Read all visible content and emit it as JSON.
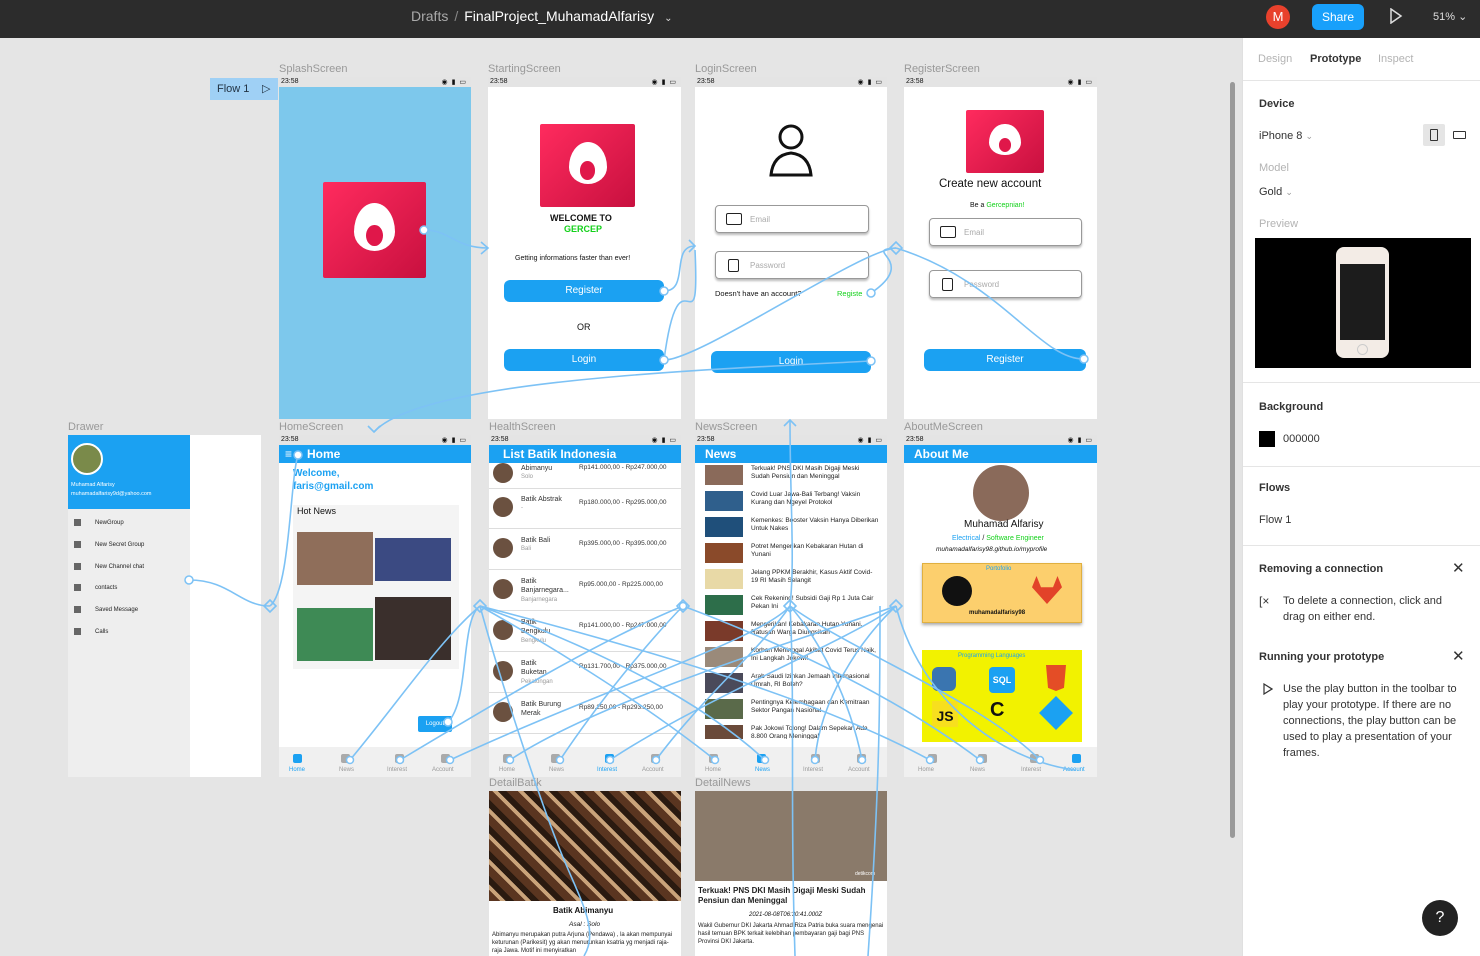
{
  "topbar": {
    "drafts": "Drafts",
    "separator": "/",
    "project": "FinalProject_MuhamadAlfarisy",
    "avatar": "M",
    "share": "Share",
    "zoom": "51%"
  },
  "canvas": {
    "flow_label": "Flow 1",
    "frames": {
      "splash": "SplashScreen",
      "starting": "StartingScreen",
      "login": "LoginScreen",
      "register": "RegisterScreen",
      "drawer": "Drawer",
      "home": "HomeScreen",
      "health": "HealthScreen",
      "news": "NewsScreen",
      "about": "AboutMeScreen",
      "detail_batik": "DetailBatik",
      "detail_news": "DetailNews"
    },
    "statusbar_time": "23:58",
    "starting": {
      "welcome": "WELCOME TO",
      "brand": "GERCEP",
      "tagline": "Getting informations faster than ever!",
      "register": "Register",
      "or": "OR",
      "login": "Login"
    },
    "login": {
      "email": "Email",
      "password": "Password",
      "no_account": "Doesn't have an account?",
      "register_link": "Registe",
      "login": "Login"
    },
    "register": {
      "title": "Create new account",
      "be_a": "Be a",
      "brand": "Gercepnian!",
      "email": "Email",
      "password": "Password",
      "button": "Register"
    },
    "drawer": {
      "name": "Muhamad Alfarisy",
      "email": "muhamadalfarisy9d@yahoo.com",
      "items": [
        "NewGroup",
        "New Secret Group",
        "New Channel chat",
        "contacts",
        "Saved Message",
        "Calls"
      ]
    },
    "home": {
      "title": "Home",
      "welcome": "Welcome,",
      "email": "faris@gmail.com",
      "hot_news": "Hot News",
      "logout": "Logout"
    },
    "health": {
      "title": "List Batik Indonesia",
      "items": [
        {
          "name": "Abimanyu",
          "sub": "Solo",
          "price": "Rp141.000,00 - Rp247.000,00"
        },
        {
          "name": "Batik Abstrak",
          "sub": "-",
          "price": "Rp180.000,00 - Rp295.000,00"
        },
        {
          "name": "Batik Bali",
          "sub": "Bali",
          "price": "Rp395.000,00 - Rp395.000,00"
        },
        {
          "name": "Batik Banjarnegara...",
          "sub": "Banjarnegara",
          "price": "Rp95.000,00 - Rp225.000,00"
        },
        {
          "name": "Batik Bengkulu",
          "sub": "Bengkulu",
          "price": "Rp141.000,00 - Rp247.000,00"
        },
        {
          "name": "Batik Buketan",
          "sub": "Pekalongan",
          "price": "Rp131.700,00 - Rp375.000,00"
        },
        {
          "name": "Batik Burung Merak",
          "sub": "",
          "price": "Rp89.250,00 - Rp293.250,00"
        }
      ]
    },
    "news": {
      "title": "News",
      "items": [
        "Terkuak! PNS DKI Masih Digaji Meski Sudah Pensiun dan Meninggal",
        "Covid Luar Jawa-Bali Terbang! Vaksin Kurang dan Ngeyel Protokol",
        "Kemenkes: Booster Vaksin Hanya Diberikan Untuk Nakes",
        "Potret Mengerikan Kebakaran Hutan di Yunani",
        "Jelang PPKM Berakhir, Kasus Aktif Covid-19 RI Masih Selangit",
        "Cek Rekening! Subsidi Gaji Rp 1 Juta Cair Pekan Ini",
        "Mengerikan! Kebakaran Hutan Yunani, Ratusan Warga Diungsikan",
        "Korban Meninggal Akibat Covid Terus Naik, Ini Langkah Jokowi!",
        "Arab Saudi Izinkan Jemaah Internasional Umrah, RI Boleh?",
        "Pentingnya Kelembagaan dan Kemitraan Sektor Pangan Nasional",
        "Pak Jokowi Tolong! Dalam Sepekan Ada 8.800 Orang Meninggal"
      ]
    },
    "about": {
      "title": "About Me",
      "name": "Muhamad Alfarisy",
      "role1": "Electrical",
      "slash": "/",
      "role2": "Software Engineer",
      "url": "muhamadalfarisy98.github.io/myprofile",
      "portfolio": "Portofolio",
      "handle": "muhamadalfarisy98",
      "languages": "Programming Languages"
    },
    "nav": {
      "home": "Home",
      "news": "News",
      "interest": "Interest",
      "account": "Account"
    },
    "detail_batik": {
      "title": "Batik Abimanyu",
      "origin": "Asal : Solo",
      "desc": "Abimanyu merupakan putra Arjuna (Pendawa) , la akan mempunyai keturunan (Parikesit) yg akan menurunkan ksatria yg menjadi raja-raja Jawa. Motif ini menyiratkan"
    },
    "detail_news": {
      "watermark": "detikcom",
      "title": "Terkuak! PNS DKI Masih Digaji Meski Sudah Pensiun dan Meninggal",
      "date": "2021-08-08T06:30:41.000Z",
      "desc": "Wakil Gubernur DKI Jakarta Ahmad Riza Patria buka suara mengenai hasil temuan BPK terkait kelebihan pembayaran gaji bagi PNS Provinsi DKI Jakarta."
    }
  },
  "sidebar": {
    "tabs": [
      "Design",
      "Prototype",
      "Inspect"
    ],
    "device_label": "Device",
    "device": "iPhone 8",
    "model_label": "Model",
    "model": "Gold",
    "preview_label": "Preview",
    "background_label": "Background",
    "background_hex": "000000",
    "flows_label": "Flows",
    "flow": "Flow 1",
    "removing_title": "Removing a connection",
    "removing_text": "To delete a connection, click and drag on either end.",
    "running_title": "Running your prototype",
    "running_text": "Use the play button in the toolbar to play your prototype. If there are no connections, the play button can be used to play a presentation of your frames.",
    "help": "?"
  },
  "colors": {
    "accent": "#1ba1f2",
    "brand": "#e0174a",
    "share": "#18a0fb",
    "topbar": "#2c2c2c"
  }
}
